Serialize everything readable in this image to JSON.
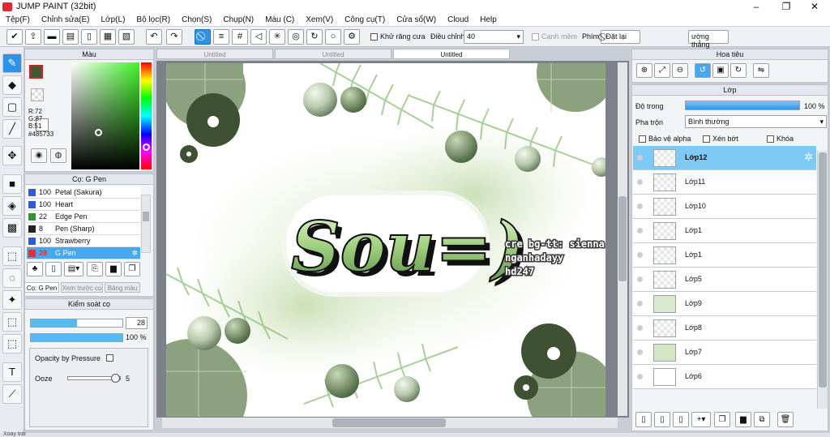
{
  "window": {
    "title": "JUMP PAINT (32bit)",
    "minimize": "–",
    "maximize": "❐",
    "close": "✕"
  },
  "menu": [
    "Tệp(F)",
    "Chỉnh sửa(E)",
    "Lớp(L)",
    "Bộ lọc(R)",
    "Chọn(S)",
    "Chụp(N)",
    "Màu (C)",
    "Xem(V)",
    "Công cụ(T)",
    "Cửa sổ(W)",
    "Cloud",
    "Help"
  ],
  "toolbar": {
    "antialias_label": "Khử răng cưa",
    "adjust_label": "Điều chỉnh",
    "adjust_value": "40",
    "edge_label": "Cạnh mềm",
    "shortcut_label": "Phím",
    "reset_label": "Đặt lại",
    "straight_label": "ường thẳng"
  },
  "color_panel": {
    "title": "Màu",
    "r": "R:72",
    "g": "G:87",
    "b": "B:51",
    "hex": "#485733",
    "fg_color": "#485733",
    "bg_color": "#ffffff"
  },
  "brush_panel": {
    "title": "Cọ: G Pen",
    "items": [
      {
        "size": "100",
        "name": "Petal (Sakura)",
        "color": "#2f5bd6"
      },
      {
        "size": "100",
        "name": "Heart",
        "color": "#2f5bd6"
      },
      {
        "size": "22",
        "name": "Edge Pen",
        "color": "#2a9a2a"
      },
      {
        "size": "8",
        "name": "Pen (Sharp)",
        "color": "#222222"
      },
      {
        "size": "100",
        "name": "Strawberry",
        "color": "#2f5bd6"
      },
      {
        "size": "28",
        "name": "G Pen",
        "color": "#e03030"
      }
    ],
    "tabs": [
      "Cọ: G Pen",
      "Xem trước cọ",
      "Bảng màu"
    ]
  },
  "brush_control": {
    "title": "Kiểm soát cọ",
    "size_value": "28",
    "opacity_value": "100 %",
    "size_fraction": 0.5,
    "opacity_fraction": 1.0,
    "opacity_pressure_label": "Opacity by Pressure",
    "ooze_label": "Ooze",
    "ooze_value": "5",
    "ooze_fraction": 0.95
  },
  "doc_tabs": [
    "Untitled",
    "Untitled",
    "Untitled"
  ],
  "canvas": {
    "main_text": "Sou=)",
    "credit_lines": [
      "cre bg-tt: sienna",
      "nganhadayy",
      "hd247"
    ]
  },
  "navigator": {
    "title": "Hoa tiêu"
  },
  "layers_panel": {
    "title": "Lớp",
    "opacity_label": "Độ trong",
    "opacity_value": "100 %",
    "opacity_fraction": 1.0,
    "blend_label": "Pha trộn",
    "blend_value": "Bình thường",
    "protect_alpha": "Bảo vệ alpha",
    "clipping": "Xén bớt",
    "lock": "Khóa",
    "layers": [
      "Lớp12",
      "Lớp11",
      "Lớp10",
      "Lớp1",
      "Lớp1",
      "Lớp5",
      "Lớp9",
      "Lớp8",
      "Lớp7",
      "Lớp6"
    ]
  },
  "status": {
    "text": "Xoay trái"
  },
  "accent": "#2e93e6"
}
